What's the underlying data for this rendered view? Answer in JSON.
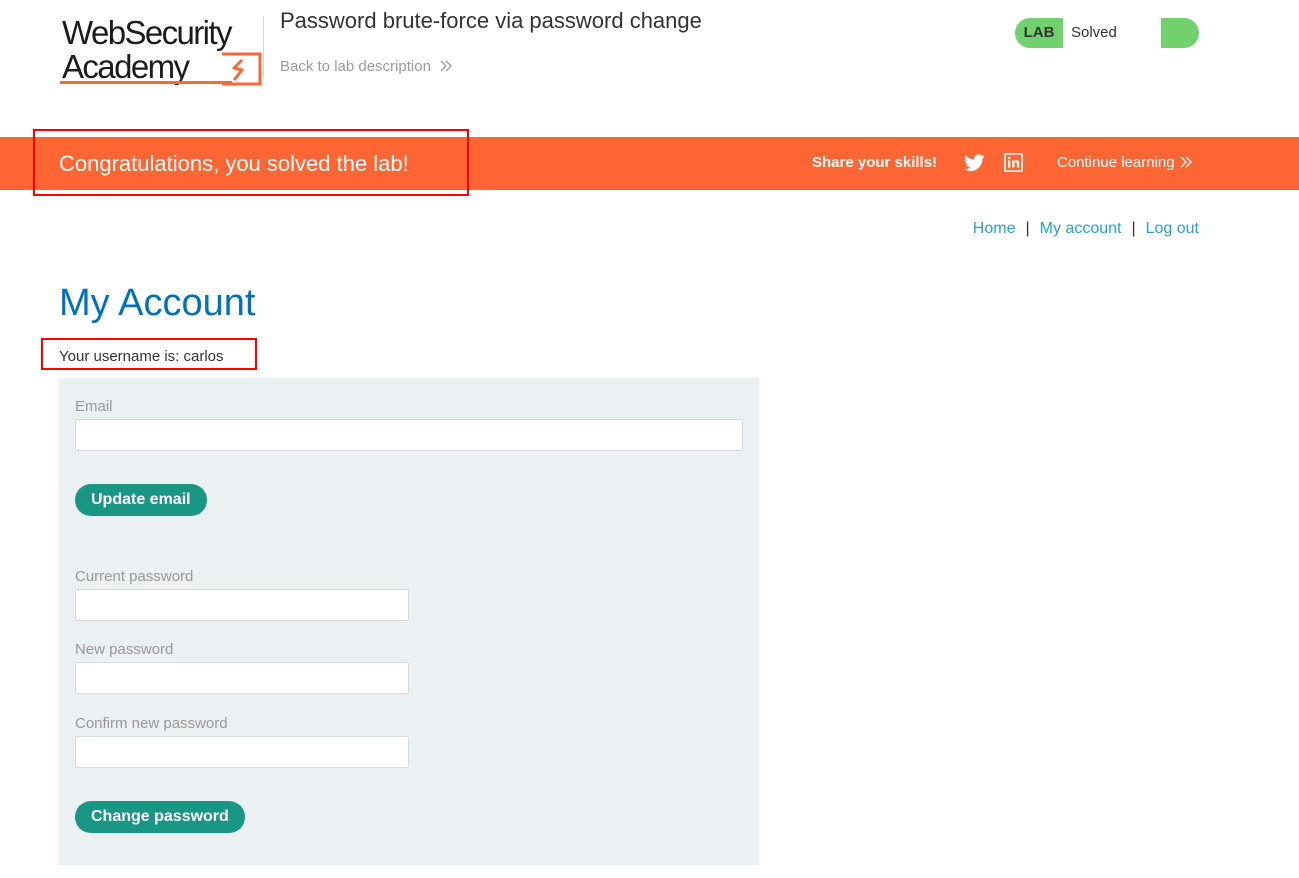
{
  "header": {
    "logo": {
      "line1": "WebSecurity",
      "line2": "Academy"
    },
    "lab_title": "Password brute-force via password change",
    "back_link": "Back to lab description",
    "lab_status": {
      "badge": "LAB",
      "value": "Solved"
    }
  },
  "banner": {
    "message": "Congratulations, you solved the lab!",
    "share_label": "Share your skills!",
    "continue_label": "Continue learning"
  },
  "nav": {
    "home": "Home",
    "my_account": "My account",
    "log_out": "Log out",
    "separator": "|"
  },
  "page": {
    "title": "My Account",
    "username_text": "Your username is: carlos"
  },
  "forms": {
    "email_label": "Email",
    "email_value": "",
    "update_email_button": "Update email",
    "current_password_label": "Current password",
    "new_password_label": "New password",
    "confirm_password_label": "Confirm new password",
    "change_password_button": "Change password"
  },
  "colors": {
    "accent_orange": "#ff6633",
    "solved_green": "#70d16d",
    "button_teal": "#1a9684",
    "title_blue": "#0071bc",
    "link_blue": "#29a0d4",
    "annotation_red": "#ff0000"
  }
}
